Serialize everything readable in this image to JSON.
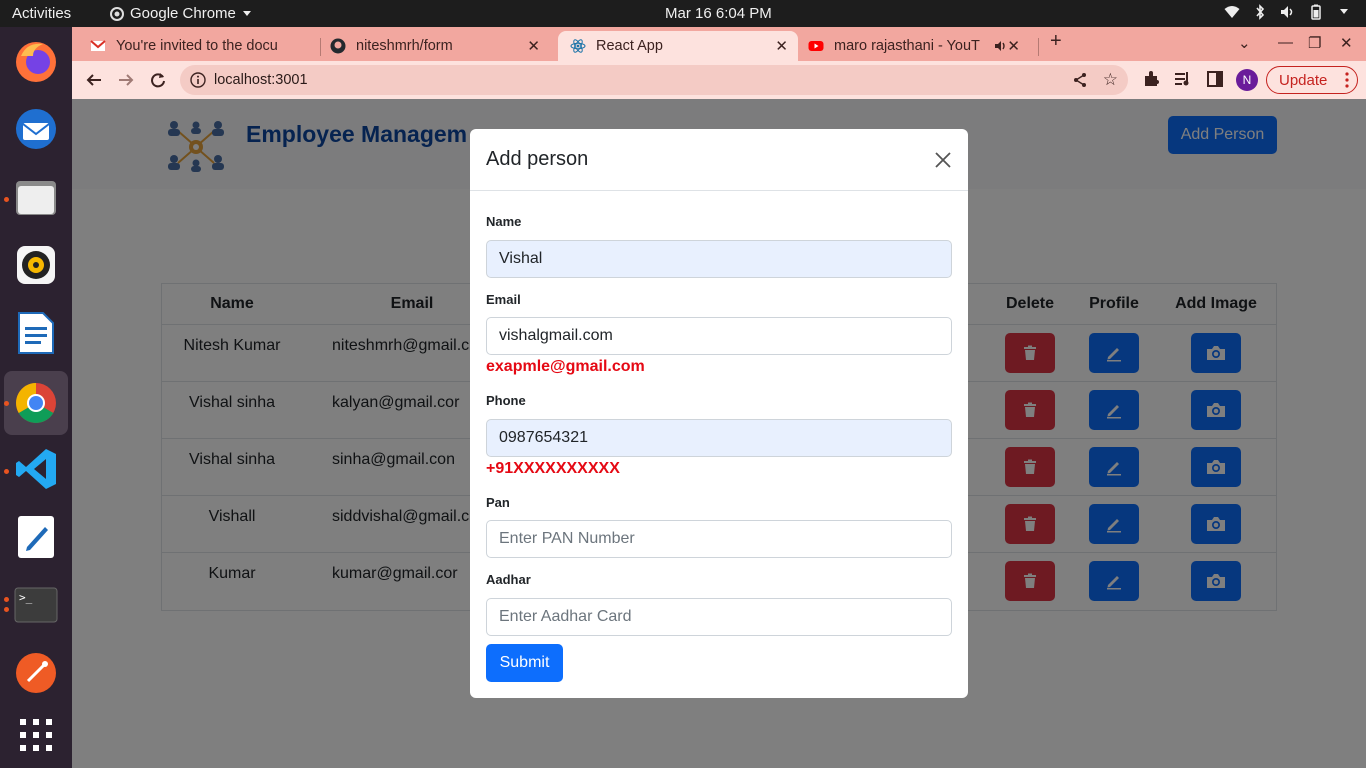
{
  "os": {
    "activities": "Activities",
    "app_name": "Google Chrome",
    "clock": "Mar 16  6:04 PM"
  },
  "browser": {
    "tabs": [
      {
        "title": "You're invited to the docu",
        "icon": "gmail-icon"
      },
      {
        "title": "niteshmrh/form",
        "icon": "github-icon"
      },
      {
        "title": "React App",
        "icon": "react-icon"
      },
      {
        "title": "maro rajasthani - YouT",
        "icon": "youtube-icon"
      }
    ],
    "url": "localhost:3001",
    "profile_initial": "N",
    "update_label": "Update"
  },
  "app": {
    "title": "Employee Managem",
    "add_person_label": "Add Person",
    "table": {
      "headers": [
        "Name",
        "Email",
        "Delete",
        "Profile",
        "Add Image"
      ],
      "rows": [
        {
          "name": "Nitesh Kumar",
          "email": "niteshmrh@gmail.c"
        },
        {
          "name": "Vishal sinha",
          "email": "kalyan@gmail.cor"
        },
        {
          "name": "Vishal sinha",
          "email": "sinha@gmail.con"
        },
        {
          "name": "Vishall",
          "email": "siddvishal@gmail.c"
        },
        {
          "name": "Kumar",
          "email": "kumar@gmail.cor"
        }
      ]
    }
  },
  "modal": {
    "title": "Add person",
    "name_label": "Name",
    "name_value": "Vishal",
    "email_label": "Email",
    "email_value": "vishalgmail.com",
    "email_hint": "exapmle@gmail.com",
    "phone_label": "Phone",
    "phone_value": "0987654321",
    "phone_hint": "+91XXXXXXXXXX",
    "pan_label": "Pan",
    "pan_placeholder": "Enter PAN Number",
    "aadhar_label": "Aadhar",
    "aadhar_placeholder": "Enter Aadhar Card",
    "submit_label": "Submit"
  },
  "colors": {
    "tab_strip": "#f2a79f",
    "toolbar": "#fde2de",
    "primary": "#0d6efd",
    "danger": "#dc3545",
    "error_text": "#e50914",
    "title_blue": "#0d47a1"
  }
}
